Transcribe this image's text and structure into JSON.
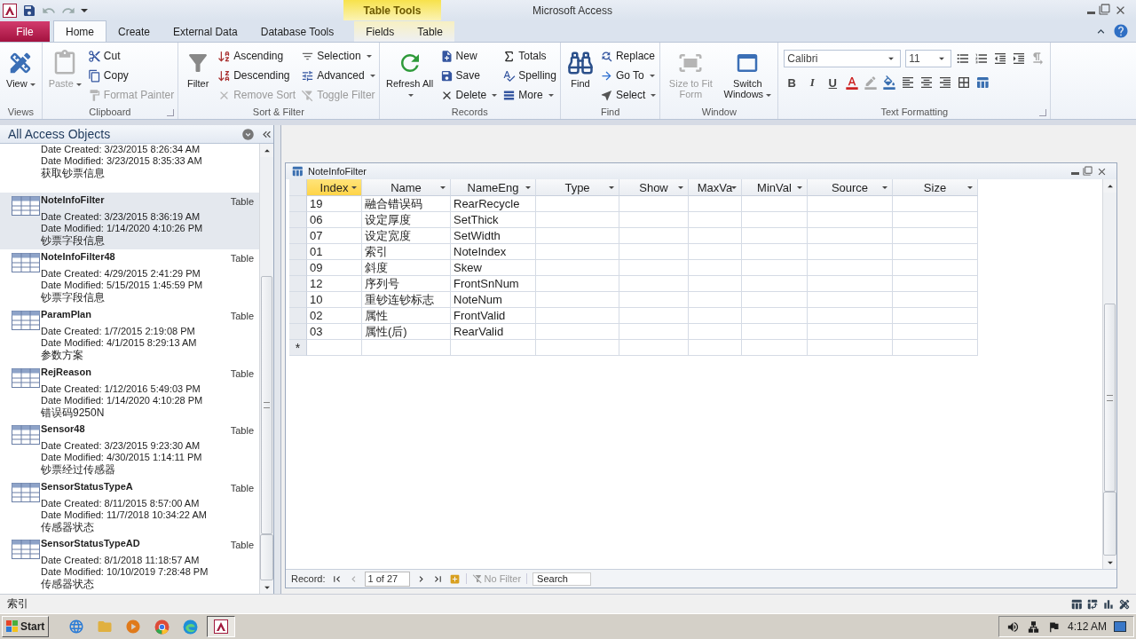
{
  "title_bar": {
    "title": "Microsoft Access",
    "context_label": "Table Tools"
  },
  "tabs": [
    {
      "label": "File",
      "kind": "file",
      "selected": false
    },
    {
      "label": "Home",
      "kind": "main",
      "selected": true
    },
    {
      "label": "Create",
      "kind": "main",
      "selected": false
    },
    {
      "label": "External Data",
      "kind": "main",
      "selected": false
    },
    {
      "label": "Database Tools",
      "kind": "main",
      "selected": false
    },
    {
      "label": "Fields",
      "kind": "context",
      "selected": false
    },
    {
      "label": "Table",
      "kind": "context",
      "selected": false
    }
  ],
  "ribbon": {
    "groups": [
      {
        "label": "Views",
        "kind": "buttons",
        "launcher": false,
        "items": [
          {
            "label": "View",
            "kind": "large",
            "dropdown": true,
            "disabled": false
          }
        ]
      },
      {
        "label": "Clipboard",
        "kind": "buttons",
        "launcher": true,
        "items": [
          {
            "label": "Paste",
            "kind": "large",
            "dropdown": true,
            "disabled": true
          },
          {
            "label": "Cut",
            "kind": "small",
            "dropdown": false,
            "disabled": false
          },
          {
            "label": "Copy",
            "kind": "small",
            "dropdown": false,
            "disabled": false
          },
          {
            "label": "Format Painter",
            "kind": "small",
            "dropdown": false,
            "disabled": true
          }
        ]
      },
      {
        "label": "Sort & Filter",
        "kind": "buttons",
        "launcher": false,
        "items": [
          {
            "label": "Filter",
            "kind": "large",
            "dropdown": false,
            "disabled": false
          },
          {
            "label": "Ascending",
            "kind": "small",
            "dropdown": false,
            "disabled": false
          },
          {
            "label": "Descending",
            "kind": "small",
            "dropdown": false,
            "disabled": false
          },
          {
            "label": "Remove Sort",
            "kind": "small",
            "dropdown": false,
            "disabled": true
          },
          {
            "label": "Selection",
            "kind": "small",
            "dropdown": true,
            "disabled": false
          },
          {
            "label": "Advanced",
            "kind": "small",
            "dropdown": true,
            "disabled": false
          },
          {
            "label": "Toggle Filter",
            "kind": "small",
            "dropdown": false,
            "disabled": true
          }
        ]
      },
      {
        "label": "Records",
        "kind": "buttons",
        "launcher": false,
        "items": [
          {
            "label": "Refresh All",
            "kind": "large",
            "dropdown": true,
            "disabled": false
          },
          {
            "label": "New",
            "kind": "small",
            "dropdown": false,
            "disabled": false
          },
          {
            "label": "Save",
            "kind": "small",
            "dropdown": false,
            "disabled": false
          },
          {
            "label": "Delete",
            "kind": "small",
            "dropdown": true,
            "disabled": false
          },
          {
            "label": "Totals",
            "kind": "small",
            "dropdown": false,
            "disabled": false
          },
          {
            "label": "Spelling",
            "kind": "small",
            "dropdown": false,
            "disabled": false
          },
          {
            "label": "More",
            "kind": "small",
            "dropdown": true,
            "disabled": false
          }
        ]
      },
      {
        "label": "Find",
        "kind": "buttons",
        "launcher": false,
        "items": [
          {
            "label": "Find",
            "kind": "large",
            "dropdown": false,
            "disabled": false
          },
          {
            "label": "Replace",
            "kind": "small",
            "dropdown": false,
            "disabled": false
          },
          {
            "label": "Go To",
            "kind": "small",
            "dropdown": true,
            "disabled": false
          },
          {
            "label": "Select",
            "kind": "small",
            "dropdown": true,
            "disabled": false
          }
        ]
      },
      {
        "label": "Window",
        "kind": "buttons",
        "launcher": false,
        "items": [
          {
            "label": "Size to Fit Form",
            "kind": "large",
            "dropdown": false,
            "disabled": true
          },
          {
            "label": "Switch Windows",
            "kind": "large",
            "dropdown": true,
            "disabled": false
          }
        ]
      },
      {
        "label": "Text Formatting",
        "kind": "format",
        "launcher": true,
        "font": "Calibri",
        "size": "11",
        "styles": [
          "B",
          "I",
          "U"
        ]
      }
    ]
  },
  "sidebar": {
    "header": "All Access Objects",
    "items": [
      {
        "created": "Date Created: 3/23/2015 8:26:34 AM",
        "modified": "Date Modified: 3/23/2015 8:35:33 AM",
        "description": "获取钞票信息",
        "selected": false
      },
      {
        "name": "NoteInfoFilter",
        "type": "Table",
        "created": "Date Created: 3/23/2015 8:36:19 AM",
        "modified": "Date Modified: 1/14/2020 4:10:26 PM",
        "description": "钞票字段信息",
        "selected": true
      },
      {
        "name": "NoteInfoFilter48",
        "type": "Table",
        "created": "Date Created: 4/29/2015 2:41:29 PM",
        "modified": "Date Modified: 5/15/2015 1:45:59 PM",
        "description": "钞票字段信息",
        "selected": false
      },
      {
        "name": "ParamPlan",
        "type": "Table",
        "created": "Date Created: 1/7/2015 2:19:08 PM",
        "modified": "Date Modified: 4/1/2015 8:29:13 AM",
        "description": "参数方案",
        "selected": false
      },
      {
        "name": "RejReason",
        "type": "Table",
        "created": "Date Created: 1/12/2016 5:49:03 PM",
        "modified": "Date Modified: 1/14/2020 4:10:28 PM",
        "description": "错误码9250N",
        "selected": false
      },
      {
        "name": "Sensor48",
        "type": "Table",
        "created": "Date Created: 3/23/2015 9:23:30 AM",
        "modified": "Date Modified: 4/30/2015 1:14:11 PM",
        "description": "钞票经过传感器",
        "selected": false
      },
      {
        "name": "SensorStatusTypeA",
        "type": "Table",
        "created": "Date Created: 8/11/2015 8:57:00 AM",
        "modified": "Date Modified: 11/7/2018 10:34:22 AM",
        "description": "传感器状态",
        "selected": false
      },
      {
        "name": "SensorStatusTypeAD",
        "type": "Table",
        "created": "Date Created: 8/1/2018 11:18:57 AM",
        "modified": "Date Modified: 10/10/2019 7:28:48 PM",
        "description": "传感器状态",
        "selected": false
      }
    ]
  },
  "document": {
    "title": "NoteInfoFilter",
    "columns": [
      {
        "label": "Index",
        "selected": true
      },
      {
        "label": "Name",
        "selected": false
      },
      {
        "label": "NameEng",
        "selected": false
      },
      {
        "label": "Type",
        "selected": false
      },
      {
        "label": "Show",
        "selected": false
      },
      {
        "label": "MaxVa",
        "selected": false
      },
      {
        "label": "MinVal",
        "selected": false
      },
      {
        "label": "Source",
        "selected": false
      },
      {
        "label": "Size",
        "selected": false
      }
    ],
    "rows": [
      {
        "cells": [
          "19",
          "融合错误码",
          "RearRecycle"
        ]
      },
      {
        "cells": [
          "06",
          "设定厚度",
          "SetThick"
        ]
      },
      {
        "cells": [
          "07",
          "设定宽度",
          "SetWidth"
        ]
      },
      {
        "cells": [
          "01",
          "索引",
          "NoteIndex"
        ]
      },
      {
        "cells": [
          "09",
          "斜度",
          "Skew"
        ]
      },
      {
        "cells": [
          "12",
          "序列号",
          "FrontSnNum"
        ]
      },
      {
        "cells": [
          "10",
          "重钞连钞标志",
          "NoteNum"
        ]
      },
      {
        "cells": [
          "02",
          "属性",
          "FrontValid"
        ]
      },
      {
        "cells": [
          "03",
          "属性(后)",
          "RearValid"
        ]
      }
    ],
    "new_row_marker": "*",
    "nav": {
      "label": "Record:",
      "position": "1 of 27",
      "filter": "No Filter",
      "search_placeholder": "Search"
    }
  },
  "status_bar": {
    "text": "索引"
  },
  "taskbar": {
    "start": "Start",
    "time": "4:12 AM",
    "apps": [
      {
        "selected": false
      },
      {
        "selected": false
      },
      {
        "selected": false
      },
      {
        "selected": false
      },
      {
        "selected": false
      },
      {
        "selected": true
      }
    ]
  }
}
